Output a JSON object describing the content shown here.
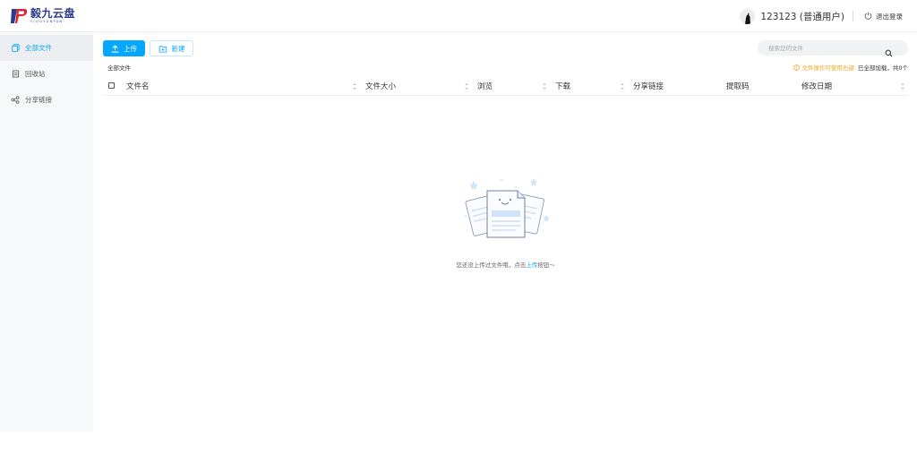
{
  "header": {
    "logo_title": "毅九云盘",
    "logo_subtitle": "YIJIUYUNPAN",
    "username": "123123 (普通用户)",
    "logout_label": "退出登录"
  },
  "sidebar": {
    "items": [
      {
        "label": "全部文件",
        "icon": "files-icon",
        "active": true
      },
      {
        "label": "回收站",
        "icon": "recycle-bin-icon",
        "active": false
      },
      {
        "label": "分享链接",
        "icon": "share-icon",
        "active": false
      }
    ]
  },
  "toolbar": {
    "upload_label": "上传",
    "new_label": "新建"
  },
  "search": {
    "placeholder": "搜索您的文件"
  },
  "breadcrumb": "全部文件",
  "status": {
    "warning": "文件操作可使用右键",
    "loaded": "已全部加载，共0个"
  },
  "table": {
    "columns": [
      "文件名",
      "文件大小",
      "浏览",
      "下载",
      "分享链接",
      "提取码",
      "修改日期"
    ]
  },
  "empty": {
    "text_before": "您还没上传过文件哦，点击",
    "link": "上传",
    "text_after": "按钮～"
  },
  "colors": {
    "accent": "#06a7ff",
    "warning": "#f5a623",
    "sidebar_bg": "#f7f8fa"
  }
}
